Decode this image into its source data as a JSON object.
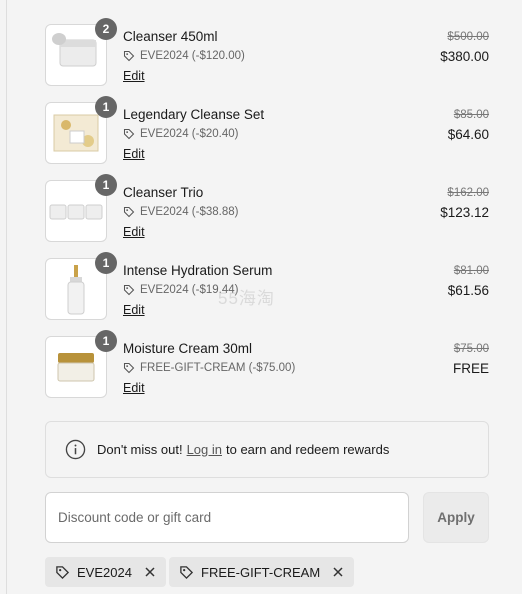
{
  "items": [
    {
      "name": "Cleanser 450ml",
      "qty": "2",
      "discount": "EVE2024 (-$120.00)",
      "original_price": "$500.00",
      "price": "$380.00",
      "edit": "Edit",
      "image": "jar"
    },
    {
      "name": "Legendary Cleanse Set",
      "qty": "1",
      "discount": "EVE2024 (-$20.40)",
      "original_price": "$85.00",
      "price": "$64.60",
      "edit": "Edit",
      "image": "giftbox"
    },
    {
      "name": "Cleanser Trio",
      "qty": "1",
      "discount": "EVE2024 (-$38.88)",
      "original_price": "$162.00",
      "price": "$123.12",
      "edit": "Edit",
      "image": "trio"
    },
    {
      "name": "Intense Hydration Serum",
      "qty": "1",
      "discount": "EVE2024 (-$19.44)",
      "original_price": "$81.00",
      "price": "$61.56",
      "edit": "Edit",
      "image": "serum"
    },
    {
      "name": "Moisture Cream 30ml",
      "qty": "1",
      "discount": "FREE-GIFT-CREAM (-$75.00)",
      "original_price": "$75.00",
      "price": "FREE",
      "edit": "Edit",
      "image": "cream"
    }
  ],
  "notice": {
    "before": "Don't miss out!",
    "link": "Log in",
    "after": "to earn and redeem rewards"
  },
  "discount_field": {
    "placeholder": "Discount code or gift card",
    "apply_label": "Apply"
  },
  "applied_codes": [
    "EVE2024",
    "FREE-GIFT-CREAM"
  ],
  "watermark": "55海淘",
  "icons": {
    "discount": "tag-icon",
    "info": "info-icon",
    "remove": "close-icon"
  }
}
